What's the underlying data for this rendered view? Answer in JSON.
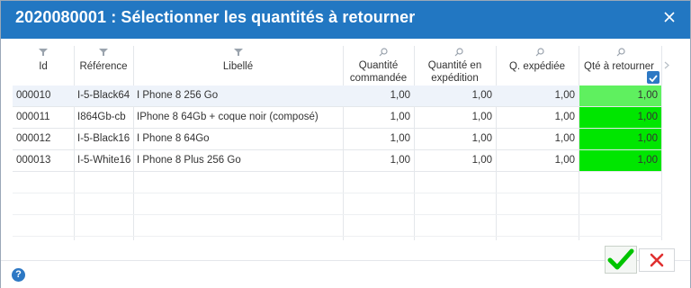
{
  "dialog": {
    "title": "2020080001 : Sélectionner les quantités à retourner"
  },
  "colors": {
    "titlebar": "#2277c2",
    "selected_green": "#00e600",
    "selected_green_light": "#5ff05f",
    "accent": "#2d78c4"
  },
  "columns": {
    "id": "Id",
    "reference": "Référence",
    "libelle": "Libellé",
    "qte_commandee_1": "Quantité",
    "qte_commandee_2": "commandée",
    "qte_expedition_1": "Quantité en",
    "qte_expedition_2": "expédition",
    "qte_expediee": "Q. expédiée",
    "qte_retourner": "Qté à retourner"
  },
  "rows": [
    {
      "id": "000010",
      "reference": "I-5-Black64",
      "libelle": "I Phone 8 256 Go",
      "qte_commandee": "1,00",
      "qte_expedition": "1,00",
      "qte_expediee": "1,00",
      "qte_retourner": "1,00"
    },
    {
      "id": "000011",
      "reference": "I864Gb-cb",
      "libelle": "IPhone 8 64Gb + coque noir (composé)",
      "qte_commandee": "1,00",
      "qte_expedition": "1,00",
      "qte_expediee": "1,00",
      "qte_retourner": "1,00"
    },
    {
      "id": "000012",
      "reference": "I-5-Black16",
      "libelle": "I Phone 8 64Go",
      "qte_commandee": "1,00",
      "qte_expedition": "1,00",
      "qte_expediee": "1,00",
      "qte_retourner": "1,00"
    },
    {
      "id": "000013",
      "reference": "I-5-White16",
      "libelle": "I Phone 8 Plus 256 Go",
      "qte_commandee": "1,00",
      "qte_expedition": "1,00",
      "qte_expediee": "1,00",
      "qte_retourner": "1,00"
    }
  ],
  "footer": {
    "help_label": "?"
  }
}
